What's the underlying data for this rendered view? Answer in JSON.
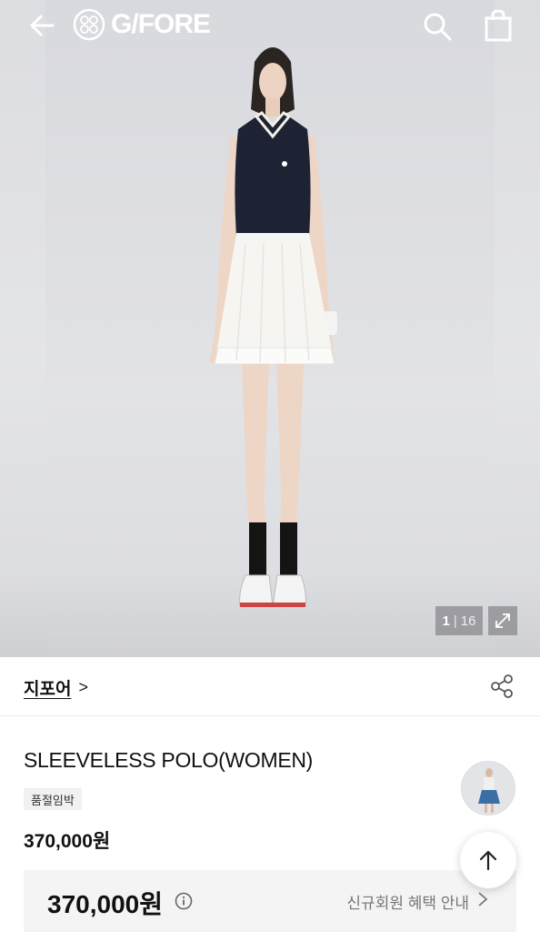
{
  "header": {
    "brand_logo_text": "G/FORE",
    "icons": [
      "back-arrow-icon",
      "search-icon",
      "shopping-bag-icon"
    ]
  },
  "gallery": {
    "current": "1",
    "separator": "|",
    "total": "16",
    "icons": [
      "expand-icon"
    ]
  },
  "brand": {
    "name": "지포어",
    "chevron": ">",
    "icons": [
      "share-icon"
    ]
  },
  "product": {
    "title": "SLEEVELESS POLO(WOMEN)",
    "badge": "품절임박",
    "price": "370,000원"
  },
  "price_box": {
    "price": "370,000원",
    "benefit_link": "신규회원 혜택 안내",
    "icons": [
      "info-icon",
      "chevron-right-icon"
    ]
  },
  "floating": {
    "icons": [
      "arrow-up-icon"
    ]
  },
  "colors": {
    "background": "#ffffff",
    "hero_bg": "#dcdde1",
    "text": "#111111",
    "muted": "#777777",
    "badge_bg": "#f1f1f1",
    "price_box_bg": "#f4f4f4"
  }
}
